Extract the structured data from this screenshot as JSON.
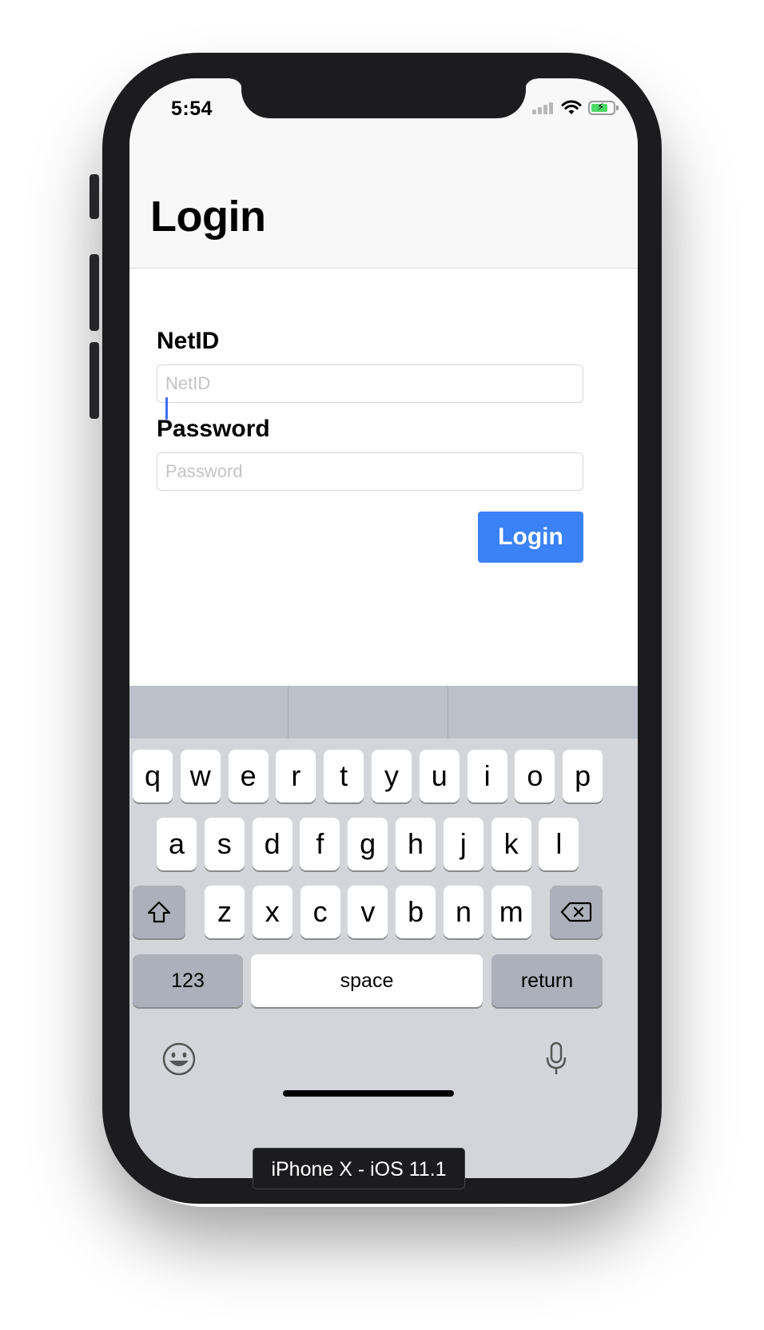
{
  "status_bar": {
    "time": "5:54",
    "icons": [
      "cellular-signal-icon",
      "wifi-icon",
      "battery-charging-icon"
    ]
  },
  "nav": {
    "title": "Login"
  },
  "form": {
    "netid_label": "NetID",
    "netid_placeholder": "NetID",
    "netid_value": "",
    "password_label": "Password",
    "password_placeholder": "Password",
    "password_value": "",
    "login_button": "Login"
  },
  "keyboard": {
    "predictions": [
      "",
      "",
      ""
    ],
    "row1": [
      "q",
      "w",
      "e",
      "r",
      "t",
      "y",
      "u",
      "i",
      "o",
      "p"
    ],
    "row2": [
      "a",
      "s",
      "d",
      "f",
      "g",
      "h",
      "j",
      "k",
      "l"
    ],
    "row3": [
      "z",
      "x",
      "c",
      "v",
      "b",
      "n",
      "m"
    ],
    "numbers_key": "123",
    "space_key": "space",
    "return_key": "return",
    "icons": [
      "shift-icon",
      "delete-icon",
      "emoji-icon",
      "microphone-icon"
    ]
  },
  "device_label": "iPhone X - iOS 11.1",
  "colors": {
    "accent": "#3b82f7",
    "keyboard_background": "#d3d5da",
    "predictive_bar": "#bcc0c8",
    "device_frame": "#1c1c1e"
  }
}
